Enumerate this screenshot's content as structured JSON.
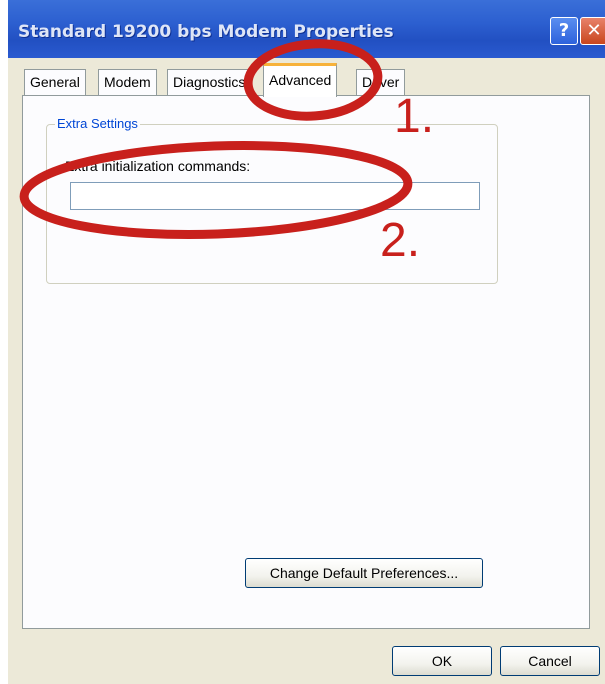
{
  "window": {
    "title": "Standard 19200 bps Modem Properties",
    "help_glyph": "?",
    "close_glyph": "✕"
  },
  "tabs": [
    {
      "label": "General",
      "active": false
    },
    {
      "label": "Modem",
      "active": false
    },
    {
      "label": "Diagnostics",
      "active": false
    },
    {
      "label": "Advanced",
      "active": true
    },
    {
      "label": "Driver",
      "active": false
    }
  ],
  "extra_settings": {
    "group_title": "Extra Settings",
    "init_label": "Extra initialization commands:",
    "init_value": ""
  },
  "buttons": {
    "change_defaults": "Change Default Preferences...",
    "ok": "OK",
    "cancel": "Cancel"
  },
  "annotations": {
    "marker_1": "1.",
    "marker_2": "2.",
    "color": "#c8201c"
  },
  "colors": {
    "titlebar": "#2c5fd0",
    "dialog_bg": "#ece9d8",
    "active_tab_accent": "#f7b23a",
    "group_title": "#0046d5"
  }
}
